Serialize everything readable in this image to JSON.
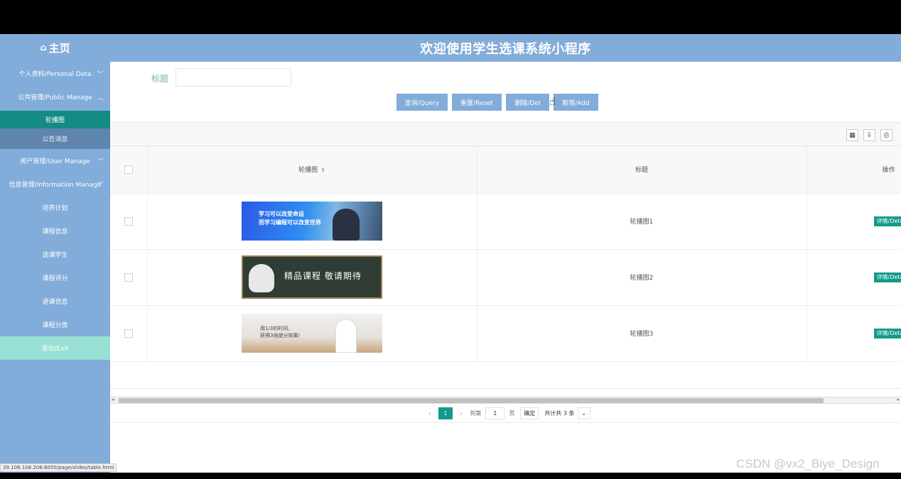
{
  "header": {
    "home_label": "主页",
    "home_icon": "home-icon",
    "site_title": "欢迎使用学生选课系统小程序"
  },
  "sidebar": {
    "items": [
      {
        "label": "个人资料/Personal Data",
        "chevron": "﹀"
      },
      {
        "label": "公共管理/Public Manage",
        "chevron": "︿"
      }
    ],
    "submenu_active": "轮播图",
    "submenu_item": "公告消息",
    "items_after": [
      {
        "label": "用户管理/User Manage",
        "chevron": "﹀"
      },
      {
        "label": "信息管理/Information Manage",
        "chevron": "﹀"
      },
      {
        "label": "培养计划"
      },
      {
        "label": "课程信息"
      },
      {
        "label": "选课学生"
      },
      {
        "label": "课程评分"
      },
      {
        "label": "退课信息"
      },
      {
        "label": "课程分类"
      }
    ],
    "exit_label": "退出/Exit"
  },
  "search": {
    "label": "标题",
    "placeholder": "",
    "value": ""
  },
  "buttons": {
    "query": "查询/Query",
    "reset": "重置/Reset",
    "delete": "删除/Del",
    "add": "新增/Add"
  },
  "table": {
    "headers": {
      "image": "轮播图",
      "title": "标题",
      "operation": "操作"
    },
    "rows": [
      {
        "title": "轮播图1",
        "action": "详情/Deta",
        "banner_text_1": "学习可以改变命运",
        "banner_text_2": "而学习编程可以改变世界"
      },
      {
        "title": "轮播图2",
        "action": "详情/Deta",
        "banner_text_1": "精品课程 敬请期待"
      },
      {
        "title": "轮播图3",
        "action": "详情/Deta",
        "banner_text_1": "用1/3的时间,",
        "banner_text_2": "获得3倍提分效果!"
      }
    ]
  },
  "pagination": {
    "prev": "‹",
    "current_page": "1",
    "next": "›",
    "goto_label": "到第",
    "goto_value": "1",
    "page_suffix": "页",
    "confirm": "确定",
    "total": "共计共 3 条",
    "limit_arrow": "⌄"
  },
  "status_url": "39.108.108.206:8050/page/slides/table.html",
  "watermark": "CSDN @vx2_Biye_Design"
}
